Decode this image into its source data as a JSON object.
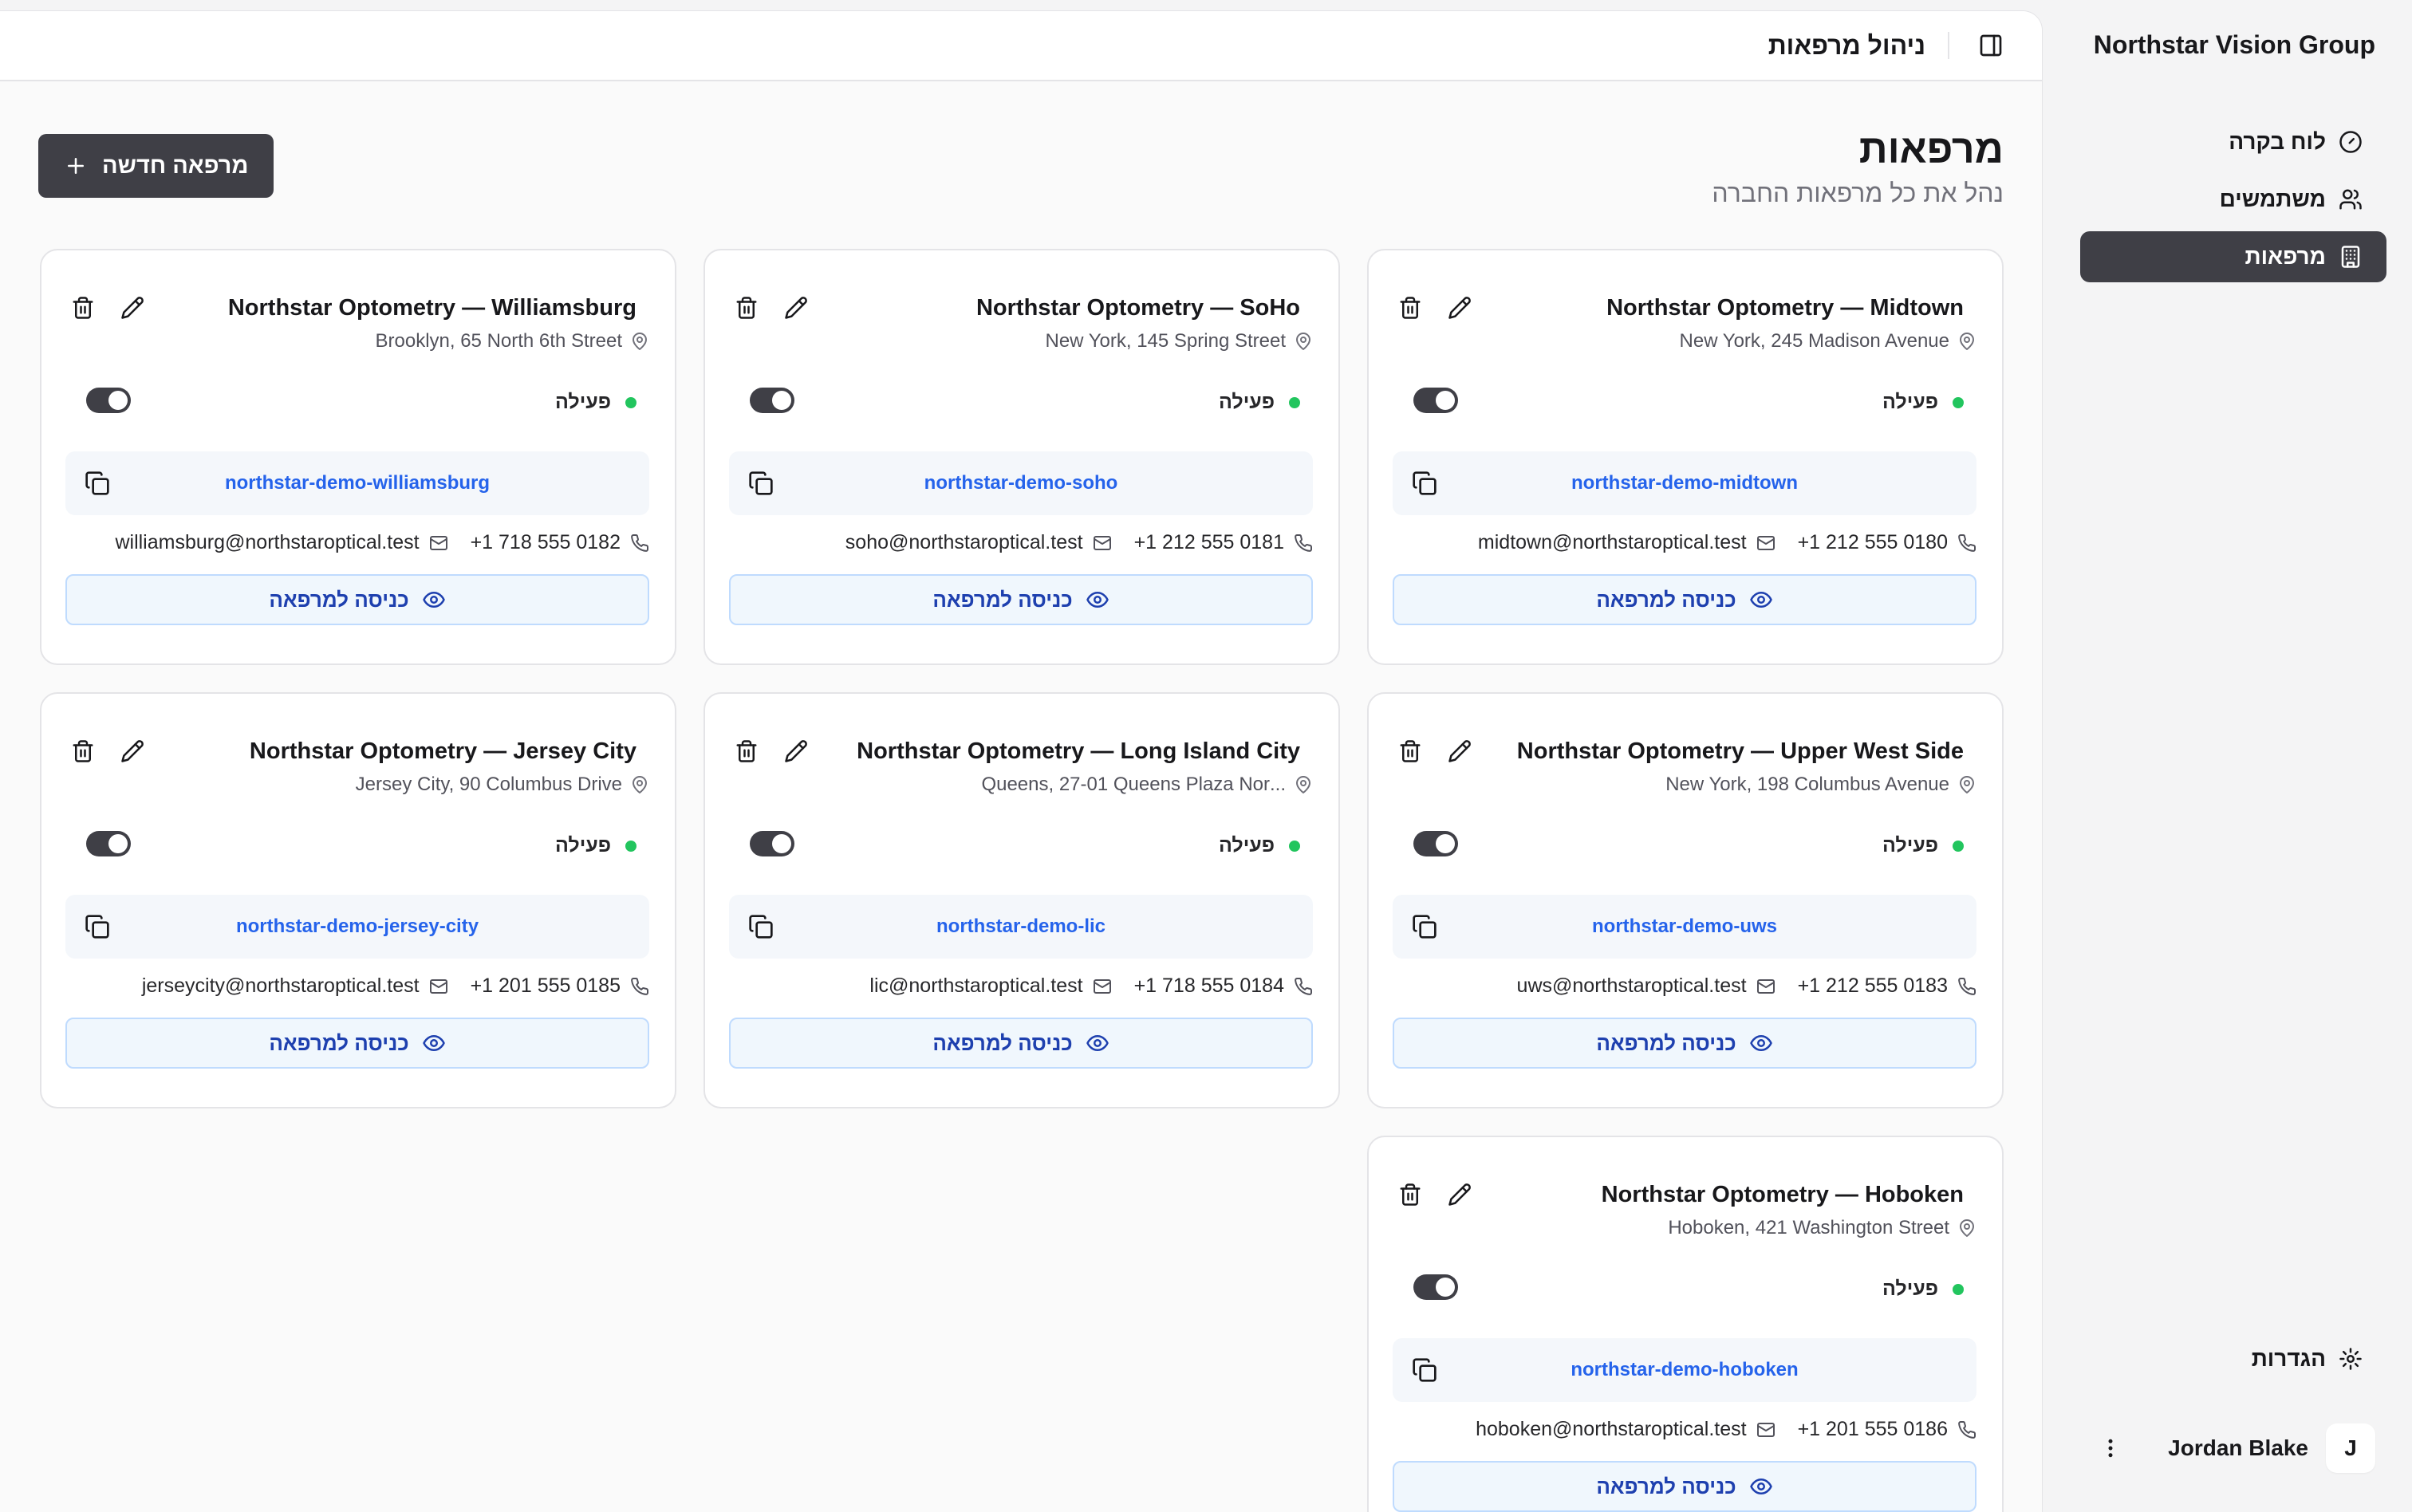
{
  "sidebar": {
    "brand": "Northstar Vision Group",
    "items": [
      {
        "label": "לוח בקרה",
        "icon": "gauge-icon",
        "active": false
      },
      {
        "label": "משתמשים",
        "icon": "users-icon",
        "active": false
      },
      {
        "label": "מרפאות",
        "icon": "building-icon",
        "active": true
      }
    ],
    "settings_label": "הגדרות",
    "user": {
      "initial": "J",
      "name": "Jordan Blake"
    }
  },
  "topbar": {
    "title": "ניהול מרפאות"
  },
  "page": {
    "title": "מרפאות",
    "subtitle": "נהל את כל מרפאות החברה",
    "new_button": "מרפאה חדשה"
  },
  "card_labels": {
    "status": "פעילה",
    "enter": "כניסה למרפאה"
  },
  "clinics": [
    {
      "name": "Northstar Optometry — Midtown",
      "address": "New York, 245 Madison Avenue",
      "slug": "northstar-demo-midtown",
      "email": "midtown@northstaroptical.test",
      "phone": "0180 555 212 1+"
    },
    {
      "name": "Northstar Optometry — SoHo",
      "address": "New York, 145 Spring Street",
      "slug": "northstar-demo-soho",
      "email": "soho@northstaroptical.test",
      "phone": "0181 555 212 1+"
    },
    {
      "name": "Northstar Optometry — Williamsburg",
      "address": "Brooklyn, 65 North 6th Street",
      "slug": "northstar-demo-williamsburg",
      "email": "williamsburg@northstaroptical.test",
      "phone": "0182 555 718 1+"
    },
    {
      "name": "Northstar Optometry — Upper West Side",
      "address": "New York, 198 Columbus Avenue",
      "slug": "northstar-demo-uws",
      "email": "uws@northstaroptical.test",
      "phone": "0183 555 212 1+"
    },
    {
      "name": "Northstar Optometry — Long Island City",
      "address": "...Queens, 27-01 Queens Plaza Nor",
      "slug": "northstar-demo-lic",
      "email": "lic@northstaroptical.test",
      "phone": "0184 555 718 1+"
    },
    {
      "name": "Northstar Optometry — Jersey City",
      "address": "Jersey City, 90 Columbus Drive",
      "slug": "northstar-demo-jersey-city",
      "email": "jerseycity@northstaroptical.test",
      "phone": "0185 555 201 1+"
    },
    {
      "name": "Northstar Optometry — Hoboken",
      "address": "Hoboken, 421 Washington Street",
      "slug": "northstar-demo-hoboken",
      "email": "hoboken@northstaroptical.test",
      "phone": "0186 555 201 1+"
    }
  ]
}
